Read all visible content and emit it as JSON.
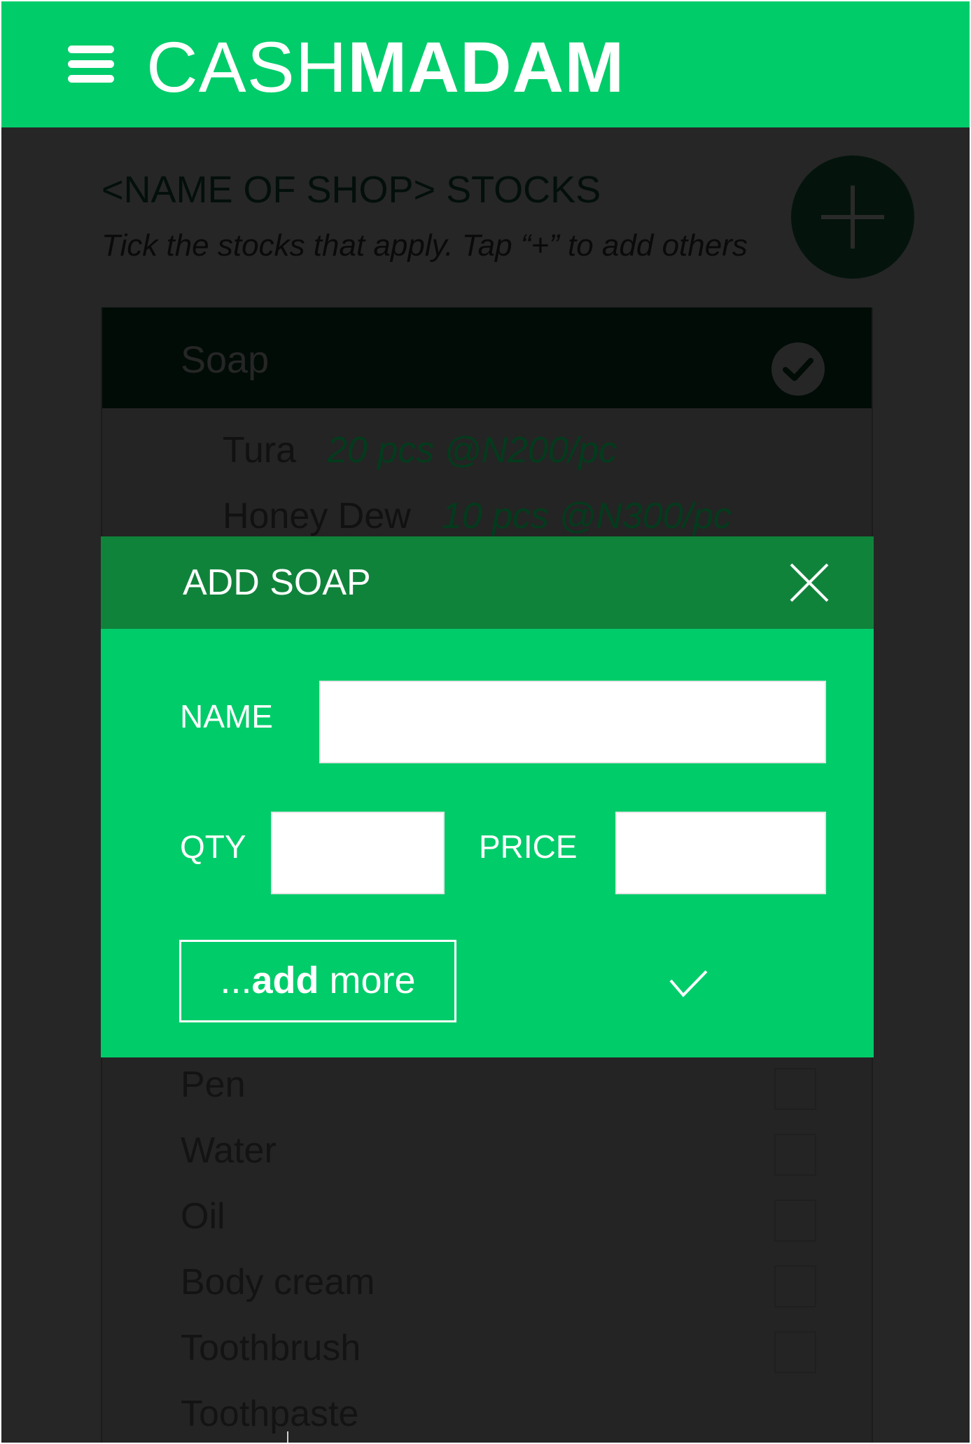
{
  "header": {
    "brand_light": "CASH",
    "brand_bold": "MADAM",
    "menu_icon": "hamburger-menu-icon",
    "background_color": "#00cc6a"
  },
  "page": {
    "title": "<NAME OF SHOP> STOCKS",
    "subtitle": "Tick the stocks that apply. Tap “+” to add others",
    "add_icon": "plus-icon"
  },
  "categories": {
    "soap": {
      "label": "Soap",
      "checked": true,
      "items": [
        {
          "name": "Tura",
          "detail": "20 pcs @N200/pc"
        },
        {
          "name": "Honey Dew",
          "detail": "10 pcs @N300/pc"
        }
      ]
    },
    "others": [
      {
        "label": "Pen"
      },
      {
        "label": "Water"
      },
      {
        "label": "Oil"
      },
      {
        "label": "Body cream"
      },
      {
        "label": "Toothbrush"
      },
      {
        "label": "Toothpaste"
      }
    ]
  },
  "modal": {
    "title": "ADD SOAP",
    "close_icon": "close-icon",
    "name_label": "NAME",
    "name_value": "",
    "qty_label": "QTY",
    "qty_value": "",
    "price_label": "PRICE",
    "price_value": "",
    "add_more_prefix": "...",
    "add_more_bold": "add",
    "add_more_suffix": " more",
    "confirm_icon": "checkmark-icon",
    "header_color": "#10833b",
    "body_color": "#00cc6a"
  }
}
